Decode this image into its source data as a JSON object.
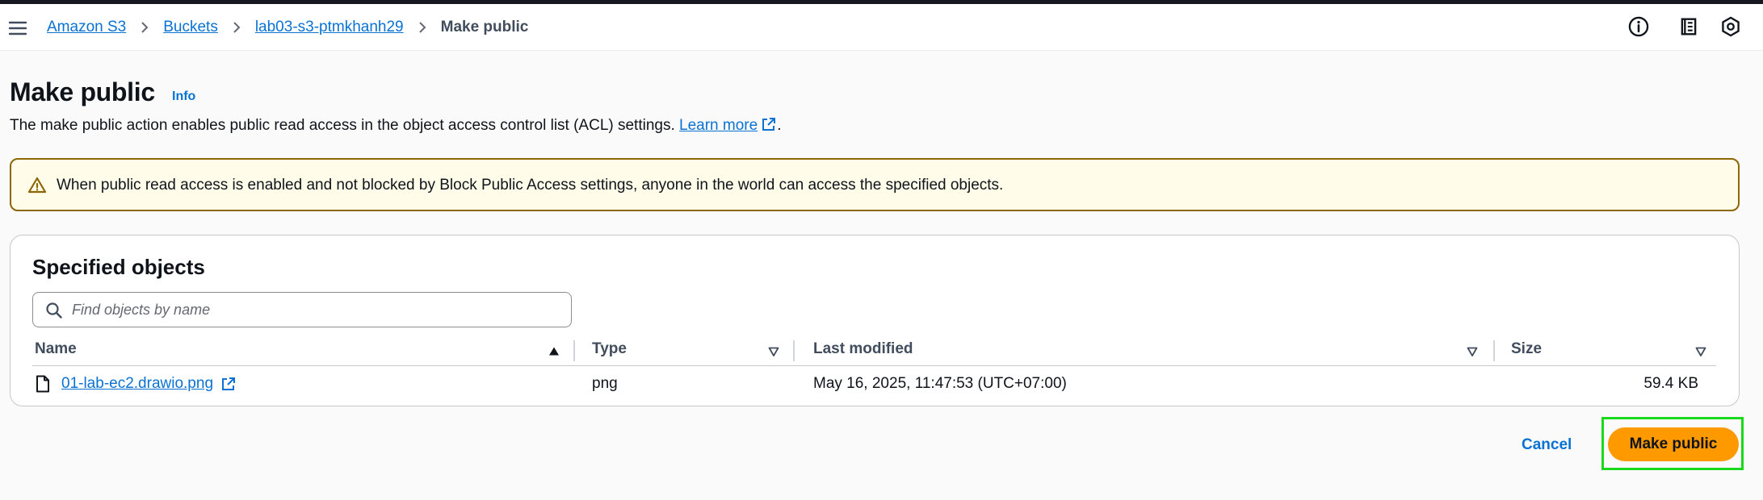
{
  "breadcrumb": {
    "items": [
      {
        "label": "Amazon S3"
      },
      {
        "label": "Buckets"
      },
      {
        "label": "lab03-s3-ptmkhanh29"
      },
      {
        "label": "Make public"
      }
    ]
  },
  "header_icons": [
    "info-circle-icon",
    "notifications-panel-icon",
    "settings-hexagon-icon"
  ],
  "page": {
    "title": "Make public",
    "info_label": "Info",
    "description": "The make public action enables public read access in the object access control list (ACL) settings.",
    "learn_more": "Learn more",
    "description_end": "."
  },
  "alert": {
    "icon": "warning-icon",
    "text": "When public read access is enabled and not blocked by Block Public Access settings, anyone in the world can access the specified objects."
  },
  "objects": {
    "title": "Specified objects",
    "search_placeholder": "Find objects by name",
    "search_value": "",
    "columns": [
      {
        "label": "Name",
        "sort": "ascending"
      },
      {
        "label": "Type",
        "sort": "none"
      },
      {
        "label": "Last modified",
        "sort": "none"
      },
      {
        "label": "Size",
        "sort": "none"
      }
    ],
    "rows": [
      {
        "name": "01-lab-ec2.drawio.png",
        "type": "png",
        "last_modified": "May 16, 2025, 11:47:53 (UTC+07:00)",
        "size": "59.4 KB"
      }
    ]
  },
  "actions": {
    "cancel": "Cancel",
    "primary": "Make public"
  },
  "colors": {
    "link": "#0972d3",
    "primary_button": "#ff9900",
    "alert_background": "#fffce9",
    "alert_border": "#8d6605",
    "highlight_outline": "#1ad81a"
  }
}
